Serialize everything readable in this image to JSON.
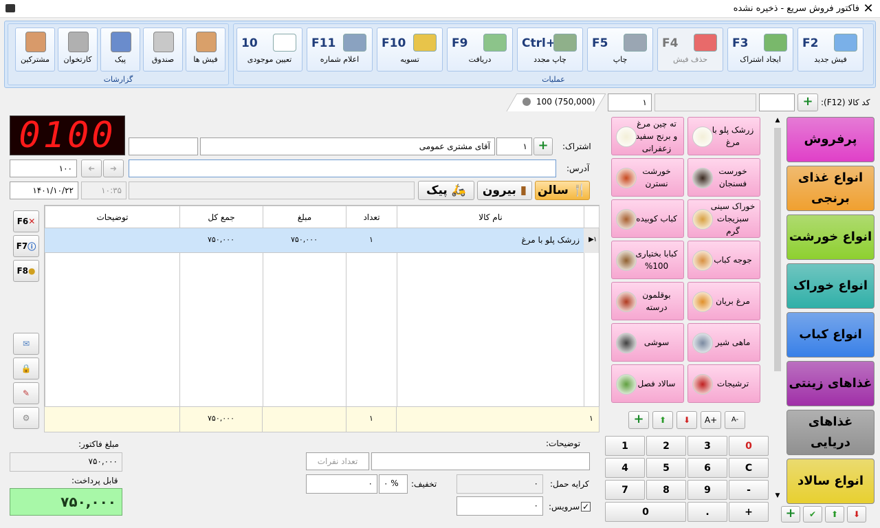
{
  "window": {
    "title": "فاکتور فروش سریع - ذخیره نشده"
  },
  "ribbon": {
    "groups": {
      "operations": "عملیات",
      "reports": "گزارشات"
    },
    "operations": [
      {
        "key": "F2",
        "label": "فیش جدید",
        "icon": "new-invoice-icon",
        "color": "#7ab0e8"
      },
      {
        "key": "F3",
        "label": "ایجاد اشتراک",
        "icon": "add-subscription-icon",
        "color": "#79b86b"
      },
      {
        "key": "F4",
        "label": "حذف فیش",
        "icon": "delete-invoice-icon",
        "color": "#e86a6a",
        "disabled": true
      },
      {
        "key": "F5",
        "label": "چاپ",
        "icon": "printer-icon",
        "color": "#9aa6b3"
      },
      {
        "key": "Ctrl+ F5",
        "label": "چاپ مجدد",
        "icon": "reprint-icon",
        "color": "#8fb08a"
      },
      {
        "key": "F9",
        "label": "دریافت",
        "icon": "receive-money-icon",
        "color": "#8cc48a"
      },
      {
        "key": "F10",
        "label": "تسویه",
        "icon": "coins-icon",
        "color": "#e8c44a"
      },
      {
        "key": "F11",
        "label": "اعلام شماره",
        "icon": "megaphone-icon",
        "color": "#8aa2c0"
      },
      {
        "key": "10",
        "label": "تعیین موجودی",
        "icon": "stock-spinner-icon",
        "color": "#ffffff"
      }
    ],
    "reports": [
      {
        "label": "فیش ها",
        "icon": "receipts-icon",
        "color": "#d9a06a"
      },
      {
        "label": "صندوق",
        "icon": "cash-register-icon",
        "color": "#c8c8c8"
      },
      {
        "label": "پیک",
        "icon": "courier-icon",
        "color": "#6a8ccc"
      },
      {
        "label": "کارتخوان",
        "icon": "card-reader-icon",
        "color": "#b0b0b0"
      },
      {
        "label": "مشترکین",
        "icon": "customers-icon",
        "color": "#d89a6a"
      }
    ]
  },
  "order": {
    "display": "0100",
    "subscription_label": "اشتراک:",
    "subscription_code": "١",
    "customer_name": "آقای مشتری عمومی",
    "address_label": "آدرس:",
    "address": "",
    "number_field": "١٠٠",
    "date": "١۴٠١/١٠/٢٢",
    "time": "١٠:٣۵",
    "mode_buttons": {
      "salon": "سالن",
      "outside": "بیرون",
      "courier": "پیک"
    },
    "status_summary": "100 (750,000)"
  },
  "grid": {
    "columns": {
      "name": "نام کالا",
      "qty": "تعداد",
      "price": "مبلغ",
      "total": "جمع کل",
      "desc": "توضیحات"
    },
    "rows": [
      {
        "num": "١",
        "name": "زرشک پلو با مرغ",
        "qty": "١",
        "price": "٧۵٠,٠٠٠",
        "total": "٧۵٠,٠٠٠",
        "desc": ""
      }
    ],
    "footer": {
      "num": "١",
      "qty": "١",
      "total": "٧۵٠,٠٠٠"
    }
  },
  "side_keys": [
    "F6",
    "F7",
    "F8"
  ],
  "bottom": {
    "desc_label": "توضیحات:",
    "people_placeholder": "تعداد نفرات",
    "freight_label": "کرایه حمل:",
    "freight": "٠",
    "discount_label": "تخفیف:",
    "discount_pct": "٠",
    "discount_sign": "%",
    "discount_amount": "٠",
    "service_label": "سرویس:",
    "service": "٠",
    "service_checked": true,
    "invoice_amount_label": "مبلغ فاکتور:",
    "invoice_amount": "٧۵٠,٠٠٠",
    "payable_label": "قابل پرداخت:",
    "payable": "٧۵٠,٠٠٠"
  },
  "product_code": {
    "label": "کد کالا (F12):",
    "qty": "١"
  },
  "categories": [
    {
      "label": "پرفروش",
      "color": "#e040c8"
    },
    {
      "label": "انواع غذای برنجی",
      "color": "#f0a030"
    },
    {
      "label": "انواع خورشت",
      "color": "#8ed030"
    },
    {
      "label": "انواع خوراک",
      "color": "#30b0a8"
    },
    {
      "label": "انواع کباب",
      "color": "#3880e8"
    },
    {
      "label": "غذاهای زینتی",
      "color": "#a030a8"
    },
    {
      "label": "غذاهای دریایی",
      "color": "#909090"
    },
    {
      "label": "انواع سالاد",
      "color": "#e8d030"
    }
  ],
  "foods": [
    {
      "label": "زرشک پلو با مرغ",
      "icon": "rice-plate-icon",
      "color": "#f3efd8"
    },
    {
      "label": "ته چین مرغ و برنج سفید زعفرانی",
      "icon": "rice-plate-icon",
      "color": "#f3efd8"
    },
    {
      "label": "خورست فسنجان",
      "icon": "stew-bowl-icon",
      "color": "#3a2a20"
    },
    {
      "label": "خورشت نسترن",
      "icon": "stew-bowl-icon",
      "color": "#c84a20"
    },
    {
      "label": "خوراک سینی سبزیجات گرم",
      "icon": "vegetables-icon",
      "color": "#d8a040"
    },
    {
      "label": "کباب کوبیده",
      "icon": "kebab-icon",
      "color": "#a86030"
    },
    {
      "label": "جوجه کباب",
      "icon": "skewer-icon",
      "color": "#d89040"
    },
    {
      "label": "کبابا بختیاری 100%",
      "icon": "bakhtiari-kebab-icon",
      "color": "#906030"
    },
    {
      "label": "مرغ بریان",
      "icon": "roast-chicken-icon",
      "color": "#e0902a"
    },
    {
      "label": "بوقلمون درسته",
      "icon": "turkey-icon",
      "color": "#b03a20"
    },
    {
      "label": "ماهی شیر",
      "icon": "fish-icon",
      "color": "#7a8aa0"
    },
    {
      "label": "سوشی",
      "icon": "sushi-icon",
      "color": "#404040"
    },
    {
      "label": "ترشیجات",
      "icon": "pickles-icon",
      "color": "#c02020"
    },
    {
      "label": "سالاد فصل",
      "icon": "salad-icon",
      "color": "#60a040"
    }
  ],
  "numpad": [
    [
      "0",
      "3",
      "2",
      "1"
    ],
    [
      "C",
      "6",
      "5",
      "4"
    ],
    [
      "-",
      "9",
      "8",
      "7"
    ],
    [
      "+",
      ".",
      "0"
    ]
  ]
}
